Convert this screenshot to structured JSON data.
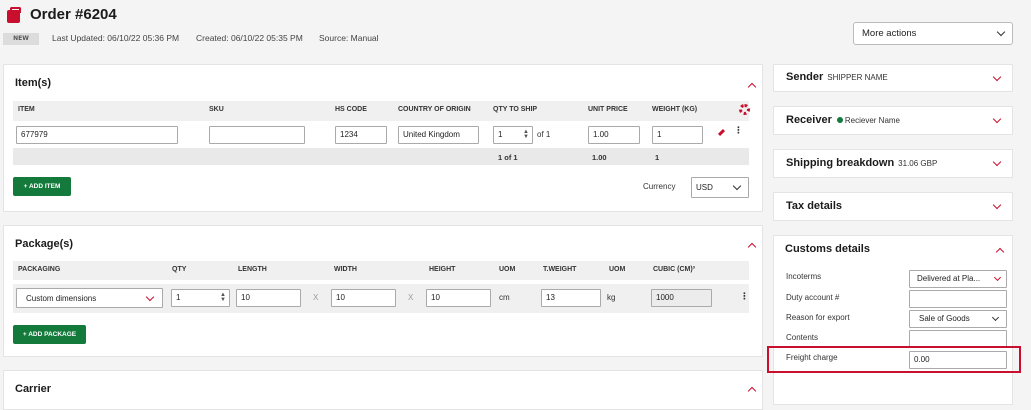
{
  "header": {
    "title": "Order #6204",
    "status": "NEW",
    "last_updated": "Last Updated: 06/10/22 05:36 PM",
    "created": "Created: 06/10/22 05:35 PM",
    "source": "Source: Manual",
    "more_actions": "More actions"
  },
  "items": {
    "title": "Item(s)",
    "columns": [
      "ITEM",
      "SKU",
      "HS CODE",
      "COUNTRY OF ORIGIN",
      "QTY TO SHIP",
      "UNIT PRICE",
      "WEIGHT (KG)"
    ],
    "row": {
      "item": "677979",
      "sku": "",
      "hs_code": "1234",
      "country": "United Kingdom",
      "qty": "1",
      "of_qty": "of 1",
      "unit_price": "1.00",
      "weight": "1"
    },
    "totals": {
      "qty": "1 of 1",
      "price": "1.00",
      "weight": "1"
    },
    "add_item": "+ ADD ITEM",
    "currency_label": "Currency",
    "currency_value": "USD"
  },
  "packages": {
    "title": "Package(s)",
    "columns": [
      "PACKAGING",
      "QTY",
      "LENGTH",
      "WIDTH",
      "HEIGHT",
      "UOM",
      "T.WEIGHT",
      "UOM",
      "CUBIC (CM)³"
    ],
    "row": {
      "packaging": "Custom dimensions",
      "qty": "1",
      "length": "10",
      "width": "10",
      "height": "10",
      "uom": "cm",
      "weight": "13",
      "weight_uom": "kg",
      "cubic": "1000",
      "x": "X"
    },
    "add_package": "+ ADD PACKAGE"
  },
  "carrier": {
    "title": "Carrier"
  },
  "sidebar": {
    "sender": {
      "title": "Sender",
      "sub": "SHIPPER NAME"
    },
    "receiver": {
      "title": "Receiver",
      "sub": "Reciever Name"
    },
    "shipping": {
      "title": "Shipping breakdown",
      "sub": "31.06 GBP"
    },
    "tax": {
      "title": "Tax details"
    },
    "customs": {
      "title": "Customs details",
      "incoterms_label": "Incoterms",
      "incoterms_value": "Delivered at Pla...",
      "duty_label": "Duty account #",
      "duty_value": "",
      "reason_label": "Reason for export",
      "reason_value": "Sale of Goods",
      "contents_label": "Contents",
      "contents_value": "",
      "freight_label": "Freight charge",
      "freight_value": "0.00"
    }
  },
  "colors": {
    "accent": "#c8102e",
    "green": "#137a3c"
  }
}
